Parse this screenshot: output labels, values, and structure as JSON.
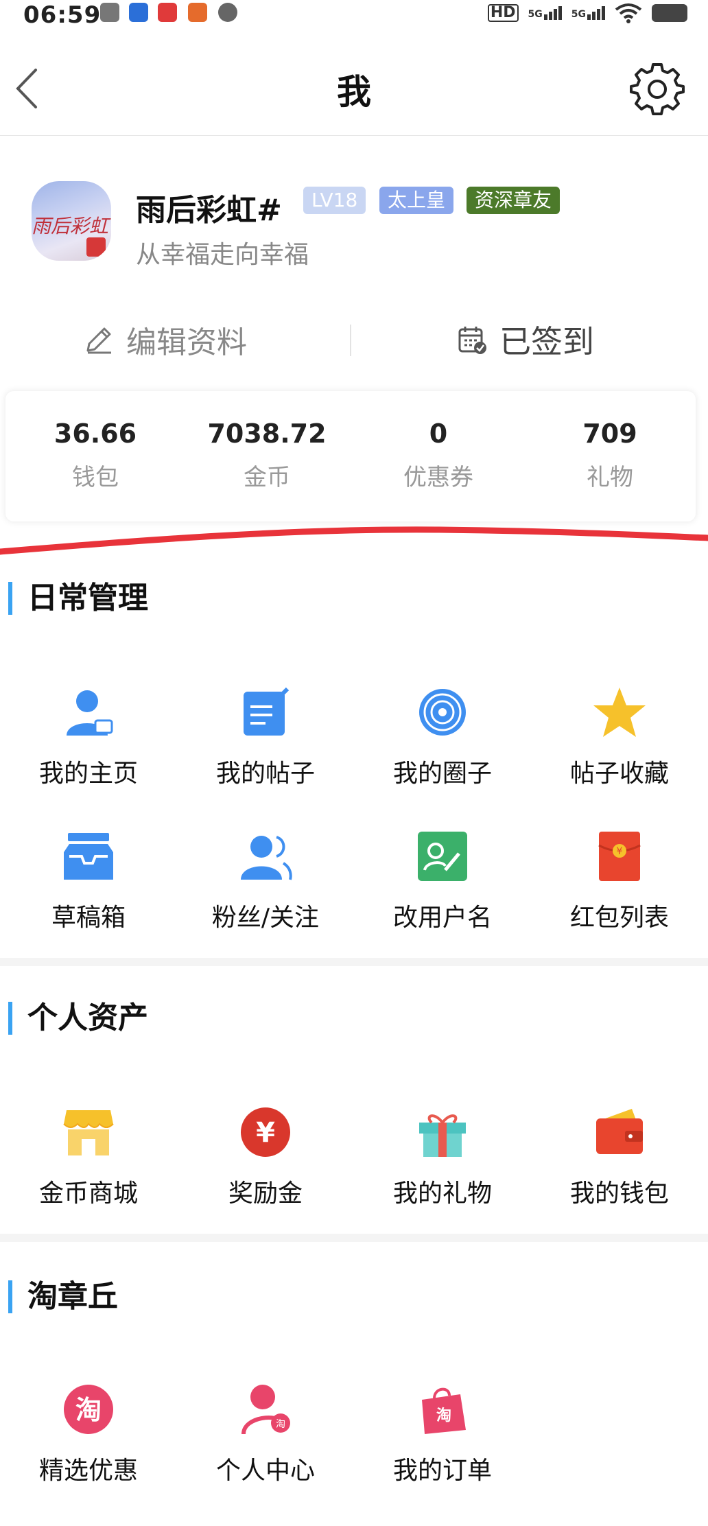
{
  "status_bar": {
    "time": "06:59",
    "network": "HD",
    "signal_1": "5G",
    "signal_2": "5G"
  },
  "header": {
    "title": "我",
    "back_icon": "chevron-left-icon",
    "settings_icon": "gear-icon"
  },
  "profile": {
    "avatar_text": "雨后彩虹",
    "username": "雨后彩虹#",
    "badges": {
      "level": "LV18",
      "title": "太上皇",
      "rank": "资深章友"
    },
    "signature": "从幸福走向幸福",
    "edit_label": "编辑资料",
    "sign_label": "已签到"
  },
  "stats": [
    {
      "value": "36.66",
      "label": "钱包"
    },
    {
      "value": "7038.72",
      "label": "金币"
    },
    {
      "value": "0",
      "label": "优惠券"
    },
    {
      "value": "709",
      "label": "礼物"
    }
  ],
  "sections": {
    "daily": {
      "title": "日常管理",
      "items": [
        {
          "label": "我的主页",
          "icon": "user-card-icon"
        },
        {
          "label": "我的帖子",
          "icon": "edit-note-icon"
        },
        {
          "label": "我的圈子",
          "icon": "circle-target-icon"
        },
        {
          "label": "帖子收藏",
          "icon": "star-icon"
        },
        {
          "label": "草稿箱",
          "icon": "inbox-tray-icon"
        },
        {
          "label": "粉丝/关注",
          "icon": "users-icon"
        },
        {
          "label": "改用户名",
          "icon": "pen-card-icon"
        },
        {
          "label": "红包列表",
          "icon": "red-envelope-icon"
        }
      ]
    },
    "assets": {
      "title": "个人资产",
      "items": [
        {
          "label": "金币商城",
          "icon": "store-icon"
        },
        {
          "label": "奖励金",
          "icon": "yen-coin-icon"
        },
        {
          "label": "我的礼物",
          "icon": "gift-box-icon"
        },
        {
          "label": "我的钱包",
          "icon": "wallet-icon"
        }
      ]
    },
    "taozhangqiu": {
      "title": "淘章丘",
      "items": [
        {
          "label": "精选优惠",
          "icon": "tao-badge-icon",
          "glyph": "淘"
        },
        {
          "label": "个人中心",
          "icon": "tao-user-icon",
          "glyph": "淘"
        },
        {
          "label": "我的订单",
          "icon": "tao-bag-icon",
          "glyph": "淘"
        }
      ]
    }
  },
  "colors": {
    "accent_blue": "#3aa3f2",
    "badge_level": "#c9d6f3",
    "badge_title": "#8aa6ec",
    "badge_rank": "#4c7a2a",
    "annotation_red": "#e8333a",
    "tao_pink": "#e8456a"
  }
}
